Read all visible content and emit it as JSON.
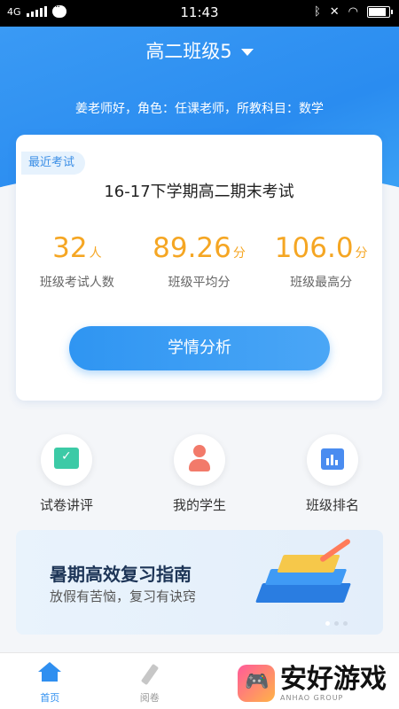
{
  "status_bar": {
    "network": "4G",
    "time": "11:43"
  },
  "header": {
    "class_title": "高二班级5",
    "greeting": "姜老师好，角色：任课老师，所教科目：数学"
  },
  "exam_card": {
    "tag": "最近考试",
    "exam_name": "16-17下学期高二期末考试",
    "stats": [
      {
        "value": "32",
        "unit": "人",
        "label": "班级考试人数"
      },
      {
        "value": "89.26",
        "unit": "分",
        "label": "班级平均分"
      },
      {
        "value": "106.0",
        "unit": "分",
        "label": "班级最高分"
      }
    ],
    "analyze_label": "学情分析"
  },
  "features": [
    {
      "label": "试卷讲评",
      "icon": "paper-review-icon"
    },
    {
      "label": "我的学生",
      "icon": "student-icon"
    },
    {
      "label": "班级排名",
      "icon": "ranking-chart-icon"
    }
  ],
  "banner": {
    "title": "暑期高效复习指南",
    "subtitle": "放假有苦恼，复习有诀窍"
  },
  "tabbar": {
    "home_label": "首页",
    "grading_label": "阅卷"
  },
  "watermark": {
    "text": "安好游戏",
    "sub": "ANHAO GROUP"
  },
  "colors": {
    "primary": "#2f8ff0",
    "score": "#f5a623"
  }
}
